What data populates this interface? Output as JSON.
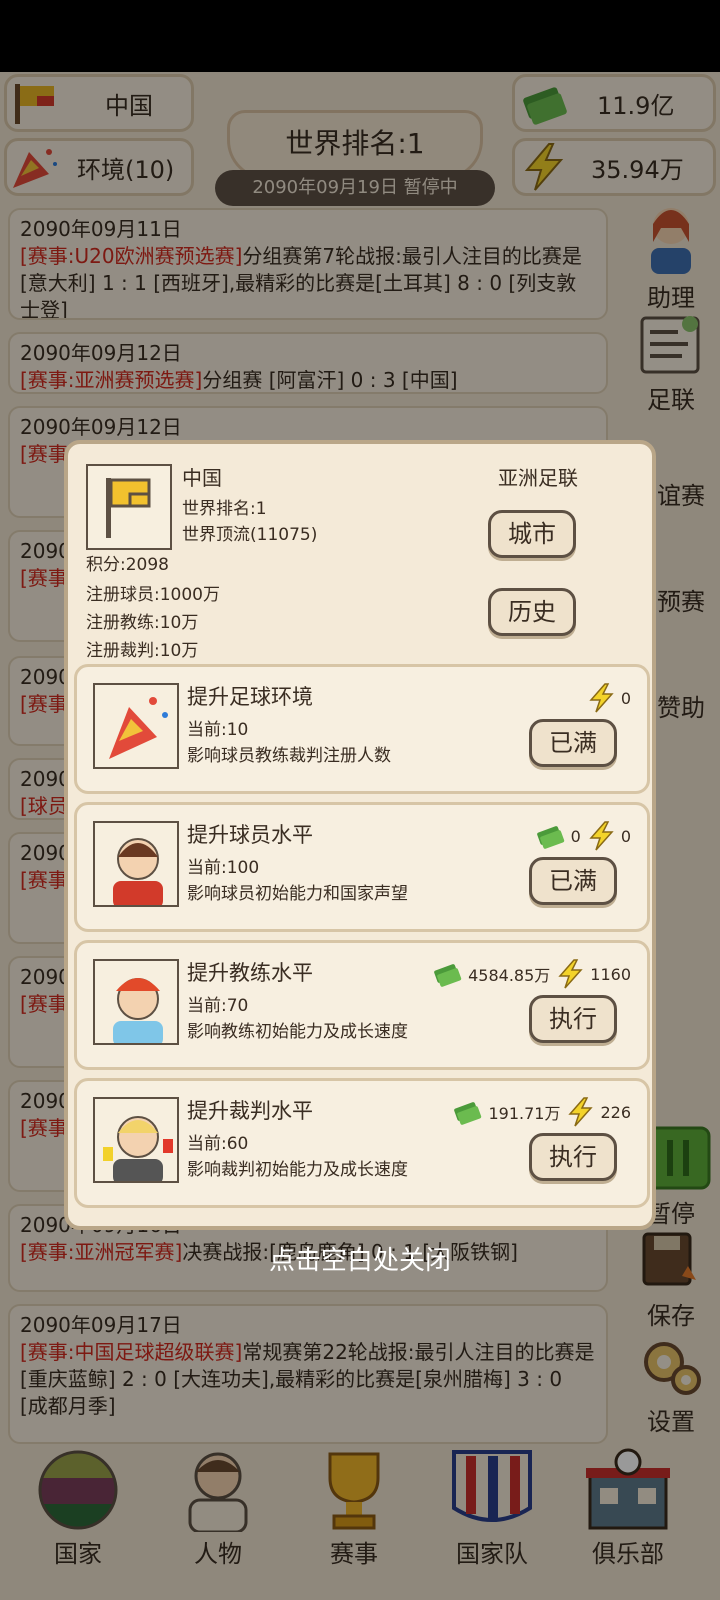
{
  "top": {
    "country": "中国",
    "environment": "环境(10)",
    "money": "11.9亿",
    "energy": "35.94万",
    "world_rank": "世界排名:1",
    "date_status": "2090年09月19日 暂停中"
  },
  "news": [
    {
      "date": "2090年09月11日",
      "tag": "[赛事:U20欧洲赛预选赛]",
      "text": "分组赛第7轮战报:最引人注目的比赛是[意大利] 1 : 1 [西班牙],最精彩的比赛是[土耳其] 8 : 0 [列支敦士登]"
    },
    {
      "date": "2090年09月12日",
      "tag": "[赛事:亚洲赛预选赛]",
      "text": "分组赛 [阿富汗] 0 : 3 [中国]"
    },
    {
      "date": "2090年09月12日",
      "tag": "[赛事",
      "text": ""
    },
    {
      "date": "2090",
      "tag": "[赛事",
      "text": "[日本 2 [韩"
    },
    {
      "date": "2090",
      "tag": "[赛事",
      "text": "[首尔"
    },
    {
      "date": "2090",
      "tag": "[球员",
      "text": ""
    },
    {
      "date": "2090",
      "tag": "[赛事",
      "text": "的比 最精"
    },
    {
      "date": "2090",
      "tag": "[赛事",
      "text": "的比 最精"
    },
    {
      "date": "2090",
      "tag": "[赛事",
      "text": "的比 最精"
    },
    {
      "date": "2090年09月16日",
      "tag": "[赛事:亚洲冠军赛]",
      "text": "决赛战报:[鹿岛鹿角] 0 : 1 [大阪铁钢]"
    },
    {
      "date": "2090年09月17日",
      "tag": "[赛事:中国足球超级联赛]",
      "text": "常规赛第22轮战报:最引人注目的比赛是[重庆蓝鲸] 2 : 0 [大连功夫],最精彩的比赛是[泉州腊梅] 3 : 0 [成都月季]"
    }
  ],
  "side": {
    "assistant": "助理",
    "federation": "足联",
    "friendly": "谊赛",
    "qualifier": "预赛",
    "sponsor": "赞助",
    "pause": "暂停",
    "save": "保存",
    "settings": "设置"
  },
  "panel": {
    "name": "中国",
    "rank": "世界排名:1",
    "level": "世界顶流(11075)",
    "points": "积分:2098",
    "confed": "亚洲足联",
    "players": "注册球员:1000万",
    "coaches": "注册教练:10万",
    "refs": "注册裁判:10万",
    "city_btn": "城市",
    "history_btn": "历史"
  },
  "cards": [
    {
      "title": "提升足球环境",
      "current": "当前:10",
      "desc": "影响球员教练裁判注册人数",
      "money": "",
      "energy": "0",
      "btn": "已满"
    },
    {
      "title": "提升球员水平",
      "current": "当前:100",
      "desc": "影响球员初始能力和国家声望",
      "money": "0",
      "energy": "0",
      "btn": "已满"
    },
    {
      "title": "提升教练水平",
      "current": "当前:70",
      "desc": "影响教练初始能力及成长速度",
      "money": "4584.85万",
      "energy": "1160",
      "btn": "执行"
    },
    {
      "title": "提升裁判水平",
      "current": "当前:60",
      "desc": "影响裁判初始能力及成长速度",
      "money": "191.71万",
      "energy": "226",
      "btn": "执行"
    }
  ],
  "close_hint": "点击空白处关闭",
  "nav": {
    "country": "国家",
    "people": "人物",
    "events": "赛事",
    "national_team": "国家队",
    "club": "俱乐部"
  }
}
